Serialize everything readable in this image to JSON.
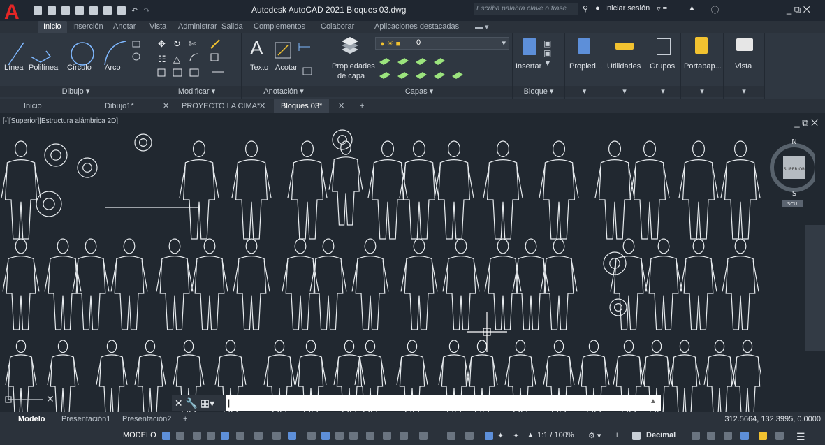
{
  "app": {
    "logo": "A",
    "title": "Autodesk AutoCAD 2021   Bloques 03.dwg",
    "search_placeholder": "Escriba palabra clave o frase",
    "signin": "Iniciar sesión",
    "window_controls": "_ ⧉ ✕"
  },
  "ribbon_tabs": [
    "Inicio",
    "Inserción",
    "Anotar",
    "Vista",
    "Administrar",
    "Salida",
    "Complementos",
    "Colaborar",
    "Aplicaciones destacadas"
  ],
  "ribbon": {
    "dibujo": {
      "title": "Dibujo ▾",
      "linea": "Línea",
      "polilinea": "Polilínea",
      "circulo": "Círculo",
      "arco": "Arco"
    },
    "modificar": {
      "title": "Modificar ▾"
    },
    "anotacion": {
      "title": "Anotación ▾",
      "texto": "Texto",
      "acotar": "Acotar"
    },
    "capas": {
      "title": "Capas ▾",
      "propiedades_1": "Propiedades",
      "propiedades_2": "de capa",
      "layer_value": "0"
    },
    "bloque": {
      "title": "Bloque ▾",
      "insertar": "Insertar"
    },
    "propiedades": "Propied...",
    "utilidades": "Utilidades",
    "grupos": "Grupos",
    "portapapeles": "Portapap...",
    "vista": "Vista"
  },
  "doc_tabs": [
    "Inicio",
    "Dibujo1*",
    "PROYECTO LA CIMA*",
    "Bloques 03*"
  ],
  "viewport": {
    "label": "[-][Superior][Estructura alámbrica 2D]",
    "viewcube": {
      "n": "N",
      "s": "S",
      "face": "SUPERIOR",
      "ucs": "SCU"
    }
  },
  "layout_tabs": [
    "Modelo",
    "Presentación1",
    "Presentación2"
  ],
  "coords": "312.5664, 132.3995, 0.0000",
  "status": {
    "modelo": "MODELO",
    "scale": "1:1 / 100%",
    "units": "Decimal"
  },
  "colors": {
    "background": "#212830",
    "accent": "#7fb8ff",
    "linework": "#e8ecef"
  }
}
